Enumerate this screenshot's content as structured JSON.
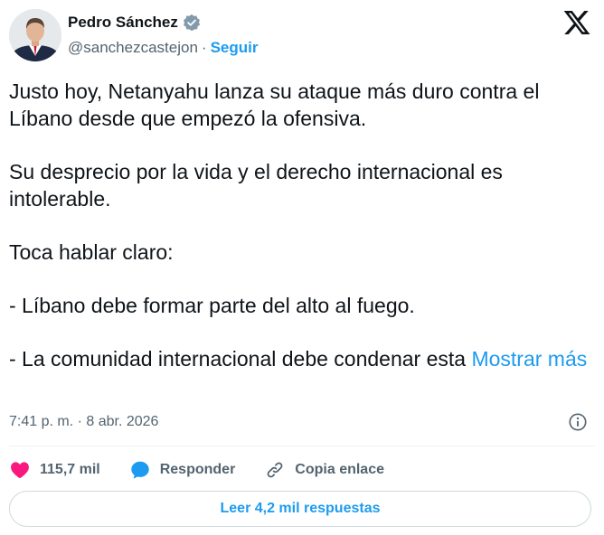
{
  "author": {
    "name": "Pedro Sánchez",
    "handle": "@sanchezcastejon",
    "separator": "·",
    "follow_label": "Seguir",
    "verified": true
  },
  "tweet": {
    "paragraphs": [
      "Justo hoy, Netanyahu lanza su ataque más duro contra el Líbano desde que empezó la ofensiva.",
      "Su desprecio por la vida y el derecho internacional es intolerable.",
      "Toca hablar claro:",
      "- Líbano debe formar parte del alto al fuego."
    ],
    "last_paragraph": "- La comunidad internacional debe condenar esta",
    "show_more_label": "Mostrar más",
    "timestamp": "7:41 p. m. · 8 abr. 2026"
  },
  "actions": {
    "likes_count": "115,7 mil",
    "reply_label": "Responder",
    "copy_link_label": "Copia enlace"
  },
  "replies_button_label": "Leer 4,2 mil respuestas",
  "icons": {
    "platform": "x-logo-icon",
    "verified": "verified-badge-icon",
    "info": "info-icon",
    "like": "heart-icon",
    "reply": "reply-bubble-icon",
    "copy_link": "link-icon"
  },
  "colors": {
    "accent": "#1d9bf0",
    "like": "#f91880",
    "text": "#0f1419",
    "muted": "#536471",
    "border": "#cfd9de"
  }
}
